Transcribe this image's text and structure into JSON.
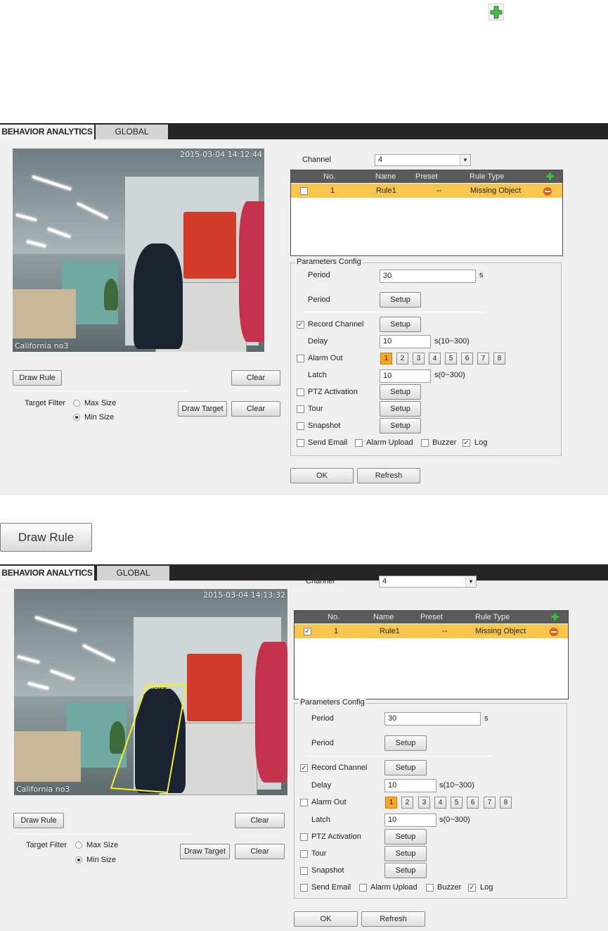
{
  "top_icon": "add-icon",
  "screens": [
    {
      "tabs": [
        "BEHAVIOR ANALYTICS",
        "GLOBAL"
      ],
      "video": {
        "timestamp": "2015-03-04 14:12:44",
        "caption": "California  no3",
        "rule_overlay": ""
      },
      "left": {
        "draw_rule": "Draw Rule",
        "clear": "Clear",
        "target_filter": "Target Filter",
        "max_size": "Max Size",
        "min_size": "Min Size",
        "draw_target": "Draw Target",
        "clear2": "Clear"
      },
      "channel": {
        "label": "Channel",
        "value": "4"
      },
      "table": {
        "headers": [
          "No.",
          "Name",
          "Preset",
          "Rule Type"
        ],
        "row": {
          "no": "1",
          "name": "Rule1",
          "preset": "--",
          "type": "Missing Object",
          "checked": false
        }
      },
      "params": {
        "legend": "Parameters Config",
        "period_label": "Period",
        "period_value": "30",
        "period_unit": "s",
        "period2_label": "Period",
        "setup": "Setup",
        "record_channel": "Record Channel",
        "delay_label": "Delay",
        "delay_value": "10",
        "delay_range": "s(10~300)",
        "alarm_out": "Alarm Out",
        "alarm_numbers": [
          "1",
          "2",
          "3",
          "4",
          "5",
          "6",
          "7",
          "8"
        ],
        "latch_label": "Latch",
        "latch_value": "10",
        "latch_range": "s(0~300)",
        "ptz": "PTZ Activation",
        "tour": "Tour",
        "snapshot": "Snapshot",
        "send_email": "Send Email",
        "alarm_upload": "Alarm Upload",
        "buzzer": "Buzzer",
        "log": "Log"
      },
      "footer": {
        "ok": "OK",
        "refresh": "Refresh"
      }
    },
    {
      "tabs": [
        "BEHAVIOR ANALYTICS",
        "GLOBAL"
      ],
      "video": {
        "timestamp": "2015-03-04 14:13:32",
        "caption": "California  no3",
        "rule_overlay": "Rule1"
      },
      "left": {
        "draw_rule": "Draw Rule",
        "clear": "Clear",
        "target_filter": "Target Filter",
        "max_size": "Max Size",
        "min_size": "Min Size",
        "draw_target": "Draw Target",
        "clear2": "Clear"
      },
      "channel": {
        "label": "Channel",
        "value": "4"
      },
      "table": {
        "headers": [
          "No.",
          "Name",
          "Preset",
          "Rule Type"
        ],
        "row": {
          "no": "1",
          "name": "Rule1",
          "preset": "--",
          "type": "Missing Object",
          "checked": true
        }
      },
      "params": {
        "legend": "Parameters Config",
        "period_label": "Period",
        "period_value": "30",
        "period_unit": "s",
        "period2_label": "Period",
        "setup": "Setup",
        "record_channel": "Record Channel",
        "delay_label": "Delay",
        "delay_value": "10",
        "delay_range": "s(10~300)",
        "alarm_out": "Alarm Out",
        "alarm_numbers": [
          "1",
          "2",
          "3",
          "4",
          "5",
          "6",
          "7",
          "8"
        ],
        "latch_label": "Latch",
        "latch_value": "10",
        "latch_range": "s(0~300)",
        "ptz": "PTZ Activation",
        "tour": "Tour",
        "snapshot": "Snapshot",
        "send_email": "Send Email",
        "alarm_upload": "Alarm Upload",
        "buzzer": "Buzzer",
        "log": "Log"
      },
      "footer": {
        "ok": "OK",
        "refresh": "Refresh"
      }
    }
  ],
  "draw_rule_callout": "Draw Rule",
  "colors": {
    "selected_row": "#f8c64c",
    "active_alarm": "#f6a623",
    "tab_bar": "#262626",
    "add_icon": "#3aa33a",
    "delete_icon": "#e85a1a"
  }
}
